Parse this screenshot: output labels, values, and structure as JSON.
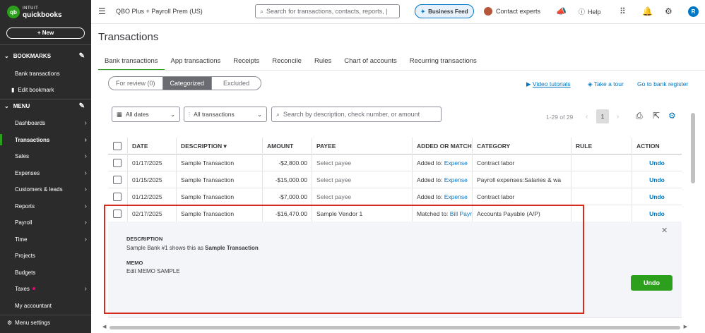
{
  "brand": {
    "line1": "INTUIT",
    "line2": "quickbooks",
    "mark": "qb"
  },
  "sidebar": {
    "new_label": "+ New",
    "bookmarks_title": "BOOKMARKS",
    "bookmark_items": [
      "Bank transactions",
      "Edit bookmark"
    ],
    "menu_title": "MENU",
    "items": [
      {
        "label": "Dashboards",
        "arrow": true
      },
      {
        "label": "Transactions",
        "arrow": true,
        "active": true
      },
      {
        "label": "Sales",
        "arrow": true
      },
      {
        "label": "Expenses",
        "arrow": true
      },
      {
        "label": "Customers & leads",
        "arrow": true
      },
      {
        "label": "Reports",
        "arrow": true
      },
      {
        "label": "Payroll",
        "arrow": true
      },
      {
        "label": "Time",
        "arrow": true
      },
      {
        "label": "Projects",
        "arrow": false
      },
      {
        "label": "Budgets",
        "arrow": false
      },
      {
        "label": "Taxes",
        "arrow": true,
        "dot": true
      },
      {
        "label": "My accountant",
        "arrow": false
      }
    ],
    "menu_settings": "Menu settings"
  },
  "topbar": {
    "company": "QBO Plus + Payroll Prem (US)",
    "search_placeholder": "Search for transactions, contacts, reports, | ",
    "business_feed": "Business Feed",
    "contact_experts": "Contact experts",
    "help": "Help",
    "user_initial": "R"
  },
  "page": {
    "title": "Transactions",
    "tabs": [
      "Bank transactions",
      "App transactions",
      "Receipts",
      "Reconcile",
      "Rules",
      "Chart of accounts",
      "Recurring transactions"
    ],
    "segments": [
      "For review (0)",
      "Categorized",
      "Excluded"
    ],
    "links": {
      "video": "Video tutorials",
      "tour": "Take a tour",
      "bank": "Go to bank register"
    },
    "filters": {
      "dates": "All dates",
      "transactions": "All transactions",
      "search_placeholder": "Search by description, check number, or amount"
    },
    "pager": {
      "range": "1-29 of 29",
      "page": "1"
    }
  },
  "table": {
    "headers": [
      "DATE",
      "DESCRIPTION",
      "AMOUNT",
      "PAYEE",
      "ADDED OR MATCHED",
      "CATEGORY",
      "RULE",
      "ACTION"
    ],
    "rows": [
      {
        "date": "01/17/2025",
        "description": "Sample Transaction",
        "amount": "-$2,800.00",
        "payee": "Select payee",
        "added_prefix": "Added to:",
        "added_link": "Expense",
        "category": "Contract labor",
        "rule": "",
        "action": "Undo"
      },
      {
        "date": "01/15/2025",
        "description": "Sample Transaction",
        "amount": "-$15,000.00",
        "payee": "Select payee",
        "added_prefix": "Added to:",
        "added_link": "Expense",
        "category": "Payroll expenses:Salaries & wa",
        "rule": "",
        "action": "Undo"
      },
      {
        "date": "01/12/2025",
        "description": "Sample Transaction",
        "amount": "-$7,000.00",
        "payee": "Select payee",
        "added_prefix": "Added to:",
        "added_link": "Expense",
        "category": "Contract labor",
        "rule": "",
        "action": "Undo"
      },
      {
        "date": "02/17/2025",
        "description": "Sample Transaction",
        "amount": "-$16,470.00",
        "payee": "Sample Vendor 1",
        "added_prefix": "Matched to:",
        "added_link": "Bill Paym",
        "category": "Accounts Payable (A/P)",
        "rule": "",
        "action": "Undo"
      }
    ]
  },
  "details": {
    "desc_label": "DESCRIPTION",
    "desc_prefix": "Sample Bank #1 shows this as ",
    "desc_value": "Sample Transaction",
    "memo_label": "MEMO",
    "memo_value": "Edit MEMO SAMPLE",
    "undo": "Undo"
  },
  "colors": {
    "accent": "#2ca01c",
    "link": "#0077c5",
    "highlight": "#d52b1e"
  }
}
